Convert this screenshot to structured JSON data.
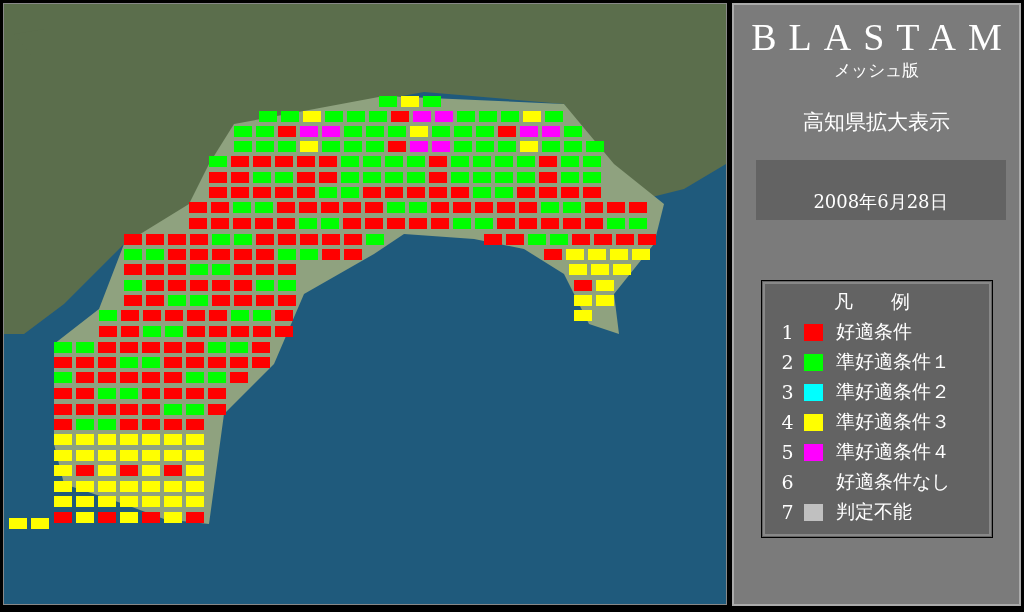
{
  "app": {
    "title": "BLASTAM",
    "subtitle": "メッシュ版",
    "view": "高知県拡大表示",
    "date": "2008年6月28日"
  },
  "legend": {
    "title": "凡　　例",
    "items": [
      {
        "number": "1",
        "label": "好適条件",
        "color": "#ff0000"
      },
      {
        "number": "2",
        "label": "準好適条件１",
        "color": "#00ff00"
      },
      {
        "number": "3",
        "label": "準好適条件２",
        "color": "#00ffff"
      },
      {
        "number": "4",
        "label": "準好適条件３",
        "color": "#ffff00"
      },
      {
        "number": "5",
        "label": "準好適条件４",
        "color": "#ff00ff"
      },
      {
        "number": "6",
        "label": "好適条件なし"
      },
      {
        "number": "7",
        "label": "判定不能",
        "color": "#c0c0c0"
      }
    ]
  }
}
